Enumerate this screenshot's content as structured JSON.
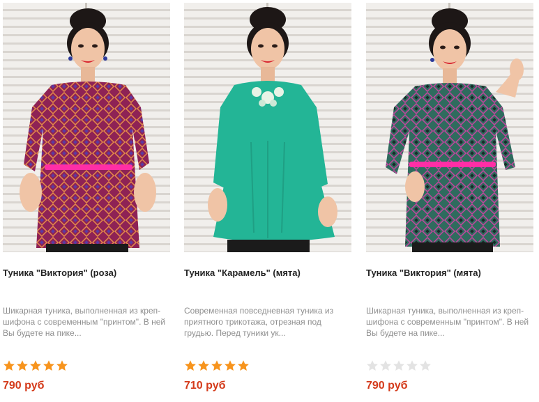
{
  "products": [
    {
      "title": "Туника \"Виктория\" (роза)",
      "description": "Шикарная туника, выполненная из креп-шифона с современным \"принтом\". В ней Вы будете на пике...",
      "rating": 5,
      "price": "790 руб",
      "photo_icon": "model-photo-icon",
      "colors": {
        "garment": "#8e2255",
        "pattern": "#e38a4a",
        "belt": "#ff2ea6"
      }
    },
    {
      "title": "Туника \"Карамель\" (мята)",
      "description": "Современная повседневная туника из приятного трикотажа, отрезная под грудью. Перед туники ук...",
      "rating": 5,
      "price": "710 руб",
      "photo_icon": "model-photo-icon",
      "colors": {
        "garment": "#23b596",
        "pattern": "#1f9f84",
        "belt": ""
      }
    },
    {
      "title": "Туника \"Виктория\" (мята)",
      "description": "Шикарная туника, выполненная из креп-шифона с современным \"принтом\". В ней Вы будете на пике...",
      "rating": 0,
      "price": "790 руб",
      "photo_icon": "model-photo-icon",
      "colors": {
        "garment": "#2f6b5e",
        "pattern": "#c2469e",
        "belt": "#ff2ea6"
      }
    }
  ],
  "theme": {
    "star_filled": "#f7941d",
    "star_empty": "#e3e3e3",
    "price_color": "#d43a1a",
    "background": "#ffffff"
  }
}
